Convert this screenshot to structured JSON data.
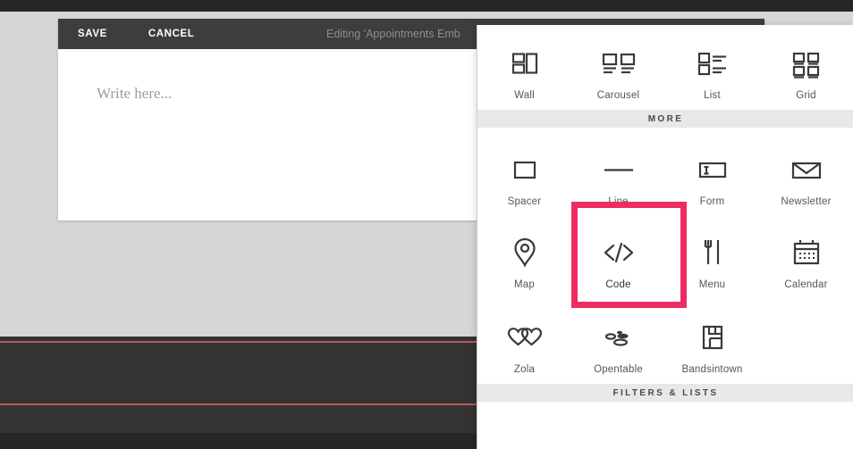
{
  "editor": {
    "save_label": "SAVE",
    "cancel_label": "CANCEL",
    "editing_label": "Editing 'Appointments Emb",
    "body_placeholder": "Write here..."
  },
  "panel": {
    "sections": [
      {
        "header": null,
        "items": [
          {
            "label": "Wall",
            "icon": "wall-icon"
          },
          {
            "label": "Carousel",
            "icon": "carousel-icon"
          },
          {
            "label": "List",
            "icon": "list-icon"
          },
          {
            "label": "Grid",
            "icon": "grid-icon"
          }
        ]
      },
      {
        "header": "MORE",
        "rows": [
          [
            {
              "label": "Spacer",
              "icon": "spacer-icon"
            },
            {
              "label": "Line",
              "icon": "line-icon"
            },
            {
              "label": "Form",
              "icon": "form-icon"
            },
            {
              "label": "Newsletter",
              "icon": "newsletter-icon"
            }
          ],
          [
            {
              "label": "Map",
              "icon": "map-pin-icon"
            },
            {
              "label": "Code",
              "icon": "code-brackets-icon",
              "selected": true
            },
            {
              "label": "Menu",
              "icon": "fork-knife-icon"
            },
            {
              "label": "Calendar",
              "icon": "calendar-icon"
            }
          ],
          [
            {
              "label": "Zola",
              "icon": "hearts-icon"
            },
            {
              "label": "Opentable",
              "icon": "opentable-icon"
            },
            {
              "label": "Bandsintown",
              "icon": "bandsintown-icon"
            }
          ]
        ]
      },
      {
        "header": "FILTERS & LISTS",
        "items": []
      }
    ]
  },
  "colors": {
    "accent_highlight": "#ed2c63",
    "toolbar_bg": "#3d3d3d",
    "panel_section_bg": "#e8e8e8",
    "footer_rule": "#b35a5a"
  }
}
